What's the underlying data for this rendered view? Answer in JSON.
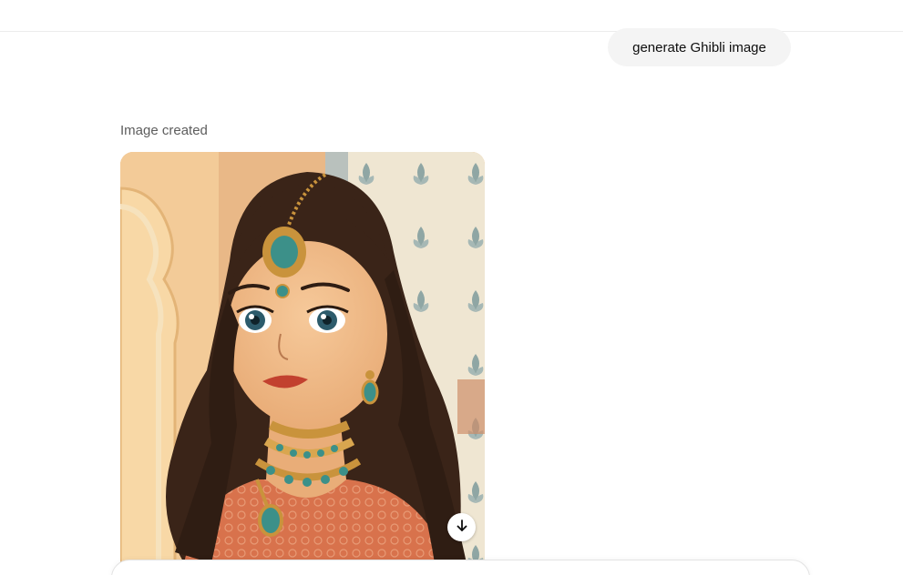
{
  "conversation": {
    "user_message": "generate Ghibli image",
    "assistant": {
      "status_label": "Image created"
    }
  },
  "icons": {
    "download": "download-arrow-icon"
  },
  "colors": {
    "user_bubble_bg": "#f4f4f4",
    "status_text": "#5d5d5d",
    "divider": "#ececec"
  }
}
